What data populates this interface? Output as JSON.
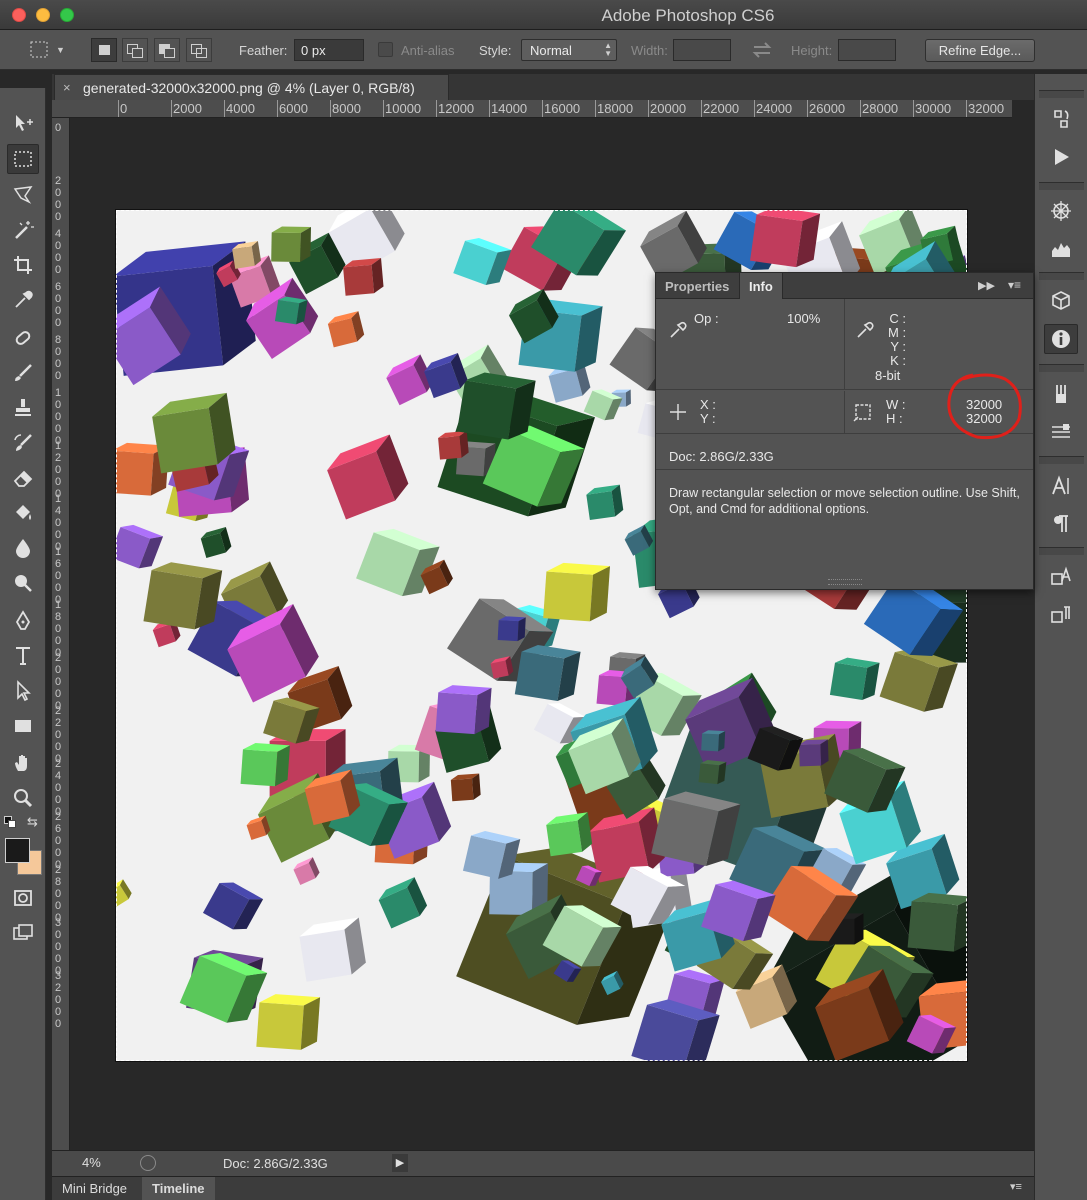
{
  "app": {
    "title": "Adobe Photoshop CS6"
  },
  "options": {
    "feather_label": "Feather:",
    "feather_value": "0 px",
    "anti_alias_label": "Anti-alias",
    "style_label": "Style:",
    "style_value": "Normal",
    "width_label": "Width:",
    "height_label": "Height:",
    "refine_label": "Refine Edge..."
  },
  "document": {
    "tab_title": "generated-32000x32000.png @ 4% (Layer 0, RGB/8)",
    "close_glyph": "×"
  },
  "ruler": {
    "h_labels": [
      "0",
      "2000",
      "4000",
      "6000",
      "8000",
      "10000",
      "12000",
      "14000",
      "16000",
      "18000",
      "20000",
      "22000",
      "24000",
      "26000",
      "28000",
      "30000",
      "32000"
    ],
    "v_labels": [
      "0",
      "2000",
      "4000",
      "6000",
      "8000",
      "10000",
      "12000",
      "14000",
      "16000",
      "18000",
      "20000",
      "22000",
      "24000",
      "26000",
      "28000",
      "30000",
      "32000"
    ]
  },
  "status": {
    "zoom": "4%",
    "doc": "Doc: 2.86G/2.33G"
  },
  "bottom_tabs": [
    {
      "label": "Mini Bridge"
    },
    {
      "label": "Timeline"
    }
  ],
  "info_panel": {
    "tabs": [
      {
        "label": "Properties"
      },
      {
        "label": "Info"
      }
    ],
    "op_label": "Op :",
    "op_value": "100%",
    "cmyk_labels": [
      "C :",
      "M :",
      "Y :",
      "K :"
    ],
    "bit_depth": "8-bit",
    "x_label": "X :",
    "y_label": "Y :",
    "w_label": "W :",
    "h_label": "H :",
    "w_value": "32000",
    "h_value": "32000",
    "doc": "Doc: 2.86G/2.33G",
    "hint": "Draw rectangular selection or move selection outline.  Use Shift, Opt, and Cmd for additional options."
  },
  "colors": {
    "foreground": "#1a1a1a",
    "background": "#f5c89a",
    "annotation": "#e0201a",
    "canvas": "#f1f1f1"
  }
}
